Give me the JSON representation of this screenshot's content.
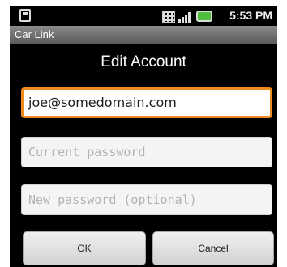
{
  "status_bar": {
    "time": "5:53 PM",
    "icons": [
      "sim-card-icon",
      "network-grid-icon",
      "signal-icon",
      "battery-icon"
    ],
    "battery_color": "#4fbf3c"
  },
  "app": {
    "title": "Car Link"
  },
  "dialog": {
    "title": "Edit Account",
    "email_value": "joe@somedomain.com",
    "current_password_placeholder": "Current password",
    "new_password_placeholder": "New password (optional)",
    "ok_label": "OK",
    "cancel_label": "Cancel",
    "focus_color": "#f08b1f"
  }
}
